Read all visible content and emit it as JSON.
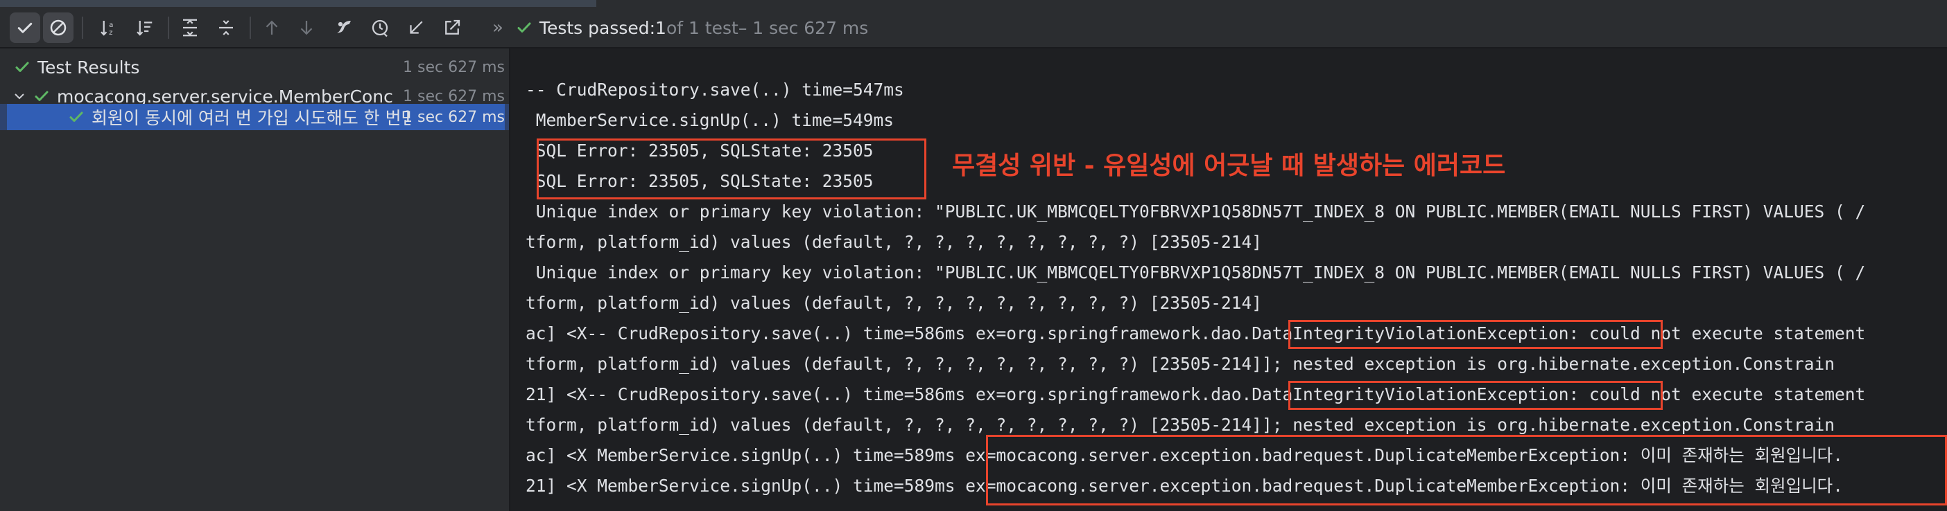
{
  "toolbar": {
    "buttons": [
      {
        "name": "show-passed-icon"
      },
      {
        "name": "show-ignored-icon"
      },
      {
        "name": "sort-alphabetically-icon"
      },
      {
        "name": "sort-by-duration-icon"
      },
      {
        "name": "expand-all-icon"
      },
      {
        "name": "collapse-all-icon"
      },
      {
        "name": "previous-failed-icon"
      },
      {
        "name": "next-failed-icon"
      },
      {
        "name": "rerun-icon"
      },
      {
        "name": "test-history-icon"
      },
      {
        "name": "import-tests-icon"
      },
      {
        "name": "export-tests-icon"
      }
    ],
    "status": {
      "chevron": "»",
      "prefix": "Tests passed: ",
      "passed": "1",
      "of_text": " of 1 test",
      "duration": " – 1 sec 627 ms"
    }
  },
  "tree": {
    "items": [
      {
        "label": "Test Results",
        "time": "1 sec 627 ms"
      },
      {
        "label": "mocacong.server.service.MemberConc",
        "time": "1 sec 627 ms"
      },
      {
        "label": "회원이 동시에 여러 번 가입 시도해도 한 번만",
        "time": "1 sec 627 ms"
      }
    ]
  },
  "console": {
    "lines": [
      "-- CrudRepository.save(..) time=547ms",
      " MemberService.signUp(..) time=549ms",
      " SQL Error: 23505, SQLState: 23505",
      " SQL Error: 23505, SQLState: 23505",
      " Unique index or primary key violation: \"PUBLIC.UK_MBMCQELTY0FBRVXP1Q58DN57T_INDEX_8 ON PUBLIC.MEMBER(EMAIL NULLS FIRST) VALUES ( /",
      "tform, platform_id) values (default, ?, ?, ?, ?, ?, ?, ?, ?) [23505-214]",
      " Unique index or primary key violation: \"PUBLIC.UK_MBMCQELTY0FBRVXP1Q58DN57T_INDEX_8 ON PUBLIC.MEMBER(EMAIL NULLS FIRST) VALUES ( /",
      "tform, platform_id) values (default, ?, ?, ?, ?, ?, ?, ?, ?) [23505-214]",
      "ac] <X-- CrudRepository.save(..) time=586ms ex=org.springframework.dao.DataIntegrityViolationException: could not execute statement",
      "tform, platform_id) values (default, ?, ?, ?, ?, ?, ?, ?, ?) [23505-214]]; nested exception is org.hibernate.exception.Constrain",
      "21] <X-- CrudRepository.save(..) time=586ms ex=org.springframework.dao.DataIntegrityViolationException: could not execute statement",
      "tform, platform_id) values (default, ?, ?, ?, ?, ?, ?, ?, ?) [23505-214]]; nested exception is org.hibernate.exception.Constrain",
      "ac] <X MemberService.signUp(..) time=589ms ex=mocacong.server.exception.badrequest.DuplicateMemberException: 이미 존재하는 회원입니다.",
      "21] <X MemberService.signUp(..) time=589ms ex=mocacong.server.exception.badrequest.DuplicateMemberException: 이미 존재하는 회원입니다."
    ],
    "annotation": "무결성 위반 - 유일성에 어긋날 때 발생하는 에러코드"
  },
  "colors": {
    "pass_green": "#5fb865",
    "highlight_red": "#e8442c",
    "selection_blue": "#3574f0"
  }
}
